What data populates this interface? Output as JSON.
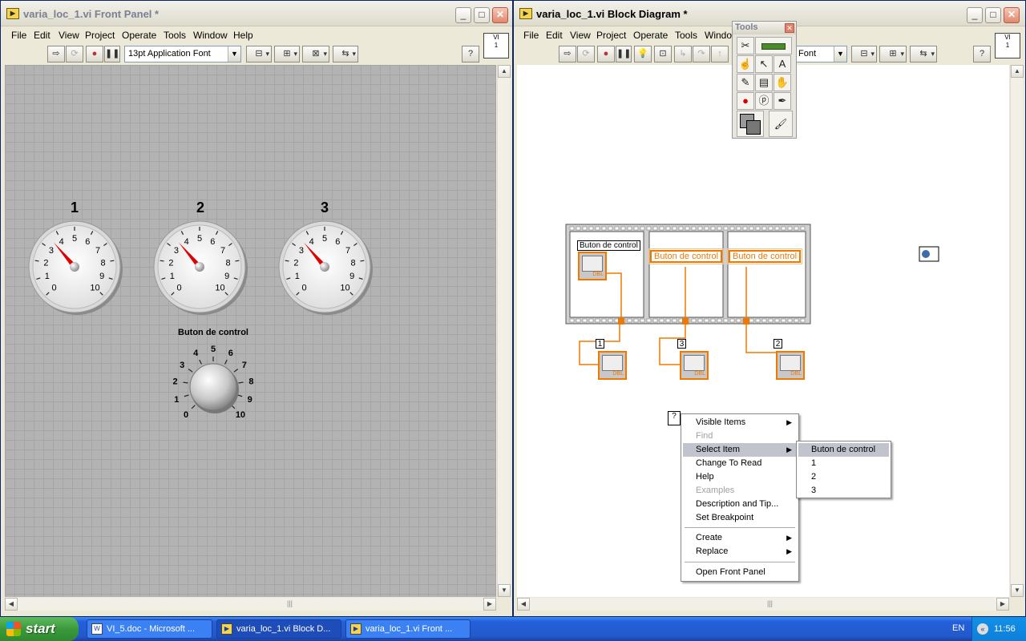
{
  "front_panel": {
    "title": "varia_loc_1.vi Front Panel *",
    "menus": [
      "File",
      "Edit",
      "View",
      "Project",
      "Operate",
      "Tools",
      "Window",
      "Help"
    ],
    "font_select": "13pt Application Font",
    "gauges": [
      {
        "label": "1",
        "scale": [
          "0",
          "1",
          "2",
          "3",
          "4",
          "5",
          "6",
          "7",
          "8",
          "9",
          "10"
        ],
        "value": 3.5
      },
      {
        "label": "2",
        "scale": [
          "0",
          "1",
          "2",
          "3",
          "4",
          "5",
          "6",
          "7",
          "8",
          "9",
          "10"
        ],
        "value": 3.5
      },
      {
        "label": "3",
        "scale": [
          "0",
          "1",
          "2",
          "3",
          "4",
          "5",
          "6",
          "7",
          "8",
          "9",
          "10"
        ],
        "value": 3.5
      }
    ],
    "knob": {
      "label": "Buton de control",
      "scale": [
        "0",
        "1",
        "2",
        "3",
        "4",
        "5",
        "6",
        "7",
        "8",
        "9",
        "10"
      ]
    }
  },
  "block_diagram": {
    "title": "varia_loc_1.vi Block Diagram *",
    "menus": [
      "File",
      "Edit",
      "View",
      "Project",
      "Operate",
      "Tools",
      "Window"
    ],
    "font_select": "Font",
    "frame1_label": "Buton de control",
    "frame2_label": "Buton de control",
    "frame3_label": "Buton de control",
    "indicator_tags": [
      "1",
      "3",
      "2"
    ],
    "dbl": "DBL",
    "unknown_node": "?"
  },
  "tools_palette": {
    "title": "Tools"
  },
  "context_menu": {
    "items": [
      {
        "label": "Visible Items",
        "state": "normal",
        "submenu": true
      },
      {
        "label": "Find",
        "state": "disabled"
      },
      {
        "label": "Select Item",
        "state": "selected",
        "submenu": true
      },
      {
        "label": "Change To Read",
        "state": "normal"
      },
      {
        "label": "Help",
        "state": "normal"
      },
      {
        "label": "Examples",
        "state": "disabled"
      },
      {
        "label": "Description and Tip...",
        "state": "normal"
      },
      {
        "label": "Set Breakpoint",
        "state": "normal"
      },
      {
        "label": "Create",
        "state": "normal",
        "submenu": true
      },
      {
        "label": "Replace",
        "state": "normal",
        "submenu": true
      },
      {
        "label": "Open Front Panel",
        "state": "normal"
      }
    ],
    "submenu": [
      "Buton de control",
      "1",
      "2",
      "3"
    ]
  },
  "taskbar": {
    "start": "start",
    "tasks": [
      "VI_5.doc - Microsoft ...",
      "varia_loc_1.vi Block D...",
      "varia_loc_1.vi Front ..."
    ],
    "lang": "EN",
    "clock": "11:56"
  }
}
